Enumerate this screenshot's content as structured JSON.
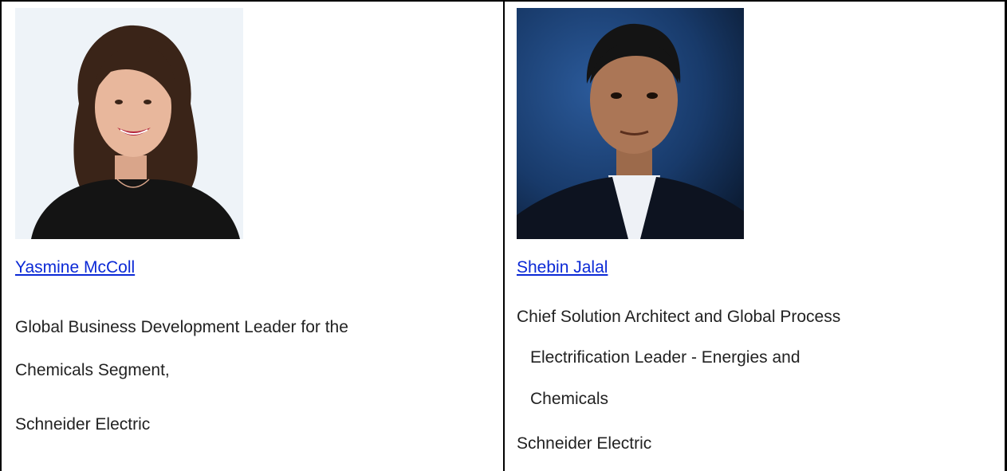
{
  "speakers": [
    {
      "name": "Yasmine McColl",
      "title_lines": [
        "Global Business Development Leader for the",
        "Chemicals Segment,"
      ],
      "company": "Schneider Electric",
      "photo_icon": "portrait-photo-woman"
    },
    {
      "name": "Shebin Jalal",
      "title_lines": [
        "Chief Solution Architect and Global Process",
        "Electrification Leader - Energies and",
        "Chemicals"
      ],
      "company": "Schneider Electric",
      "photo_icon": "portrait-photo-man"
    }
  ],
  "colors": {
    "link": "#0b29d6",
    "text": "#222222",
    "border": "#000000"
  }
}
